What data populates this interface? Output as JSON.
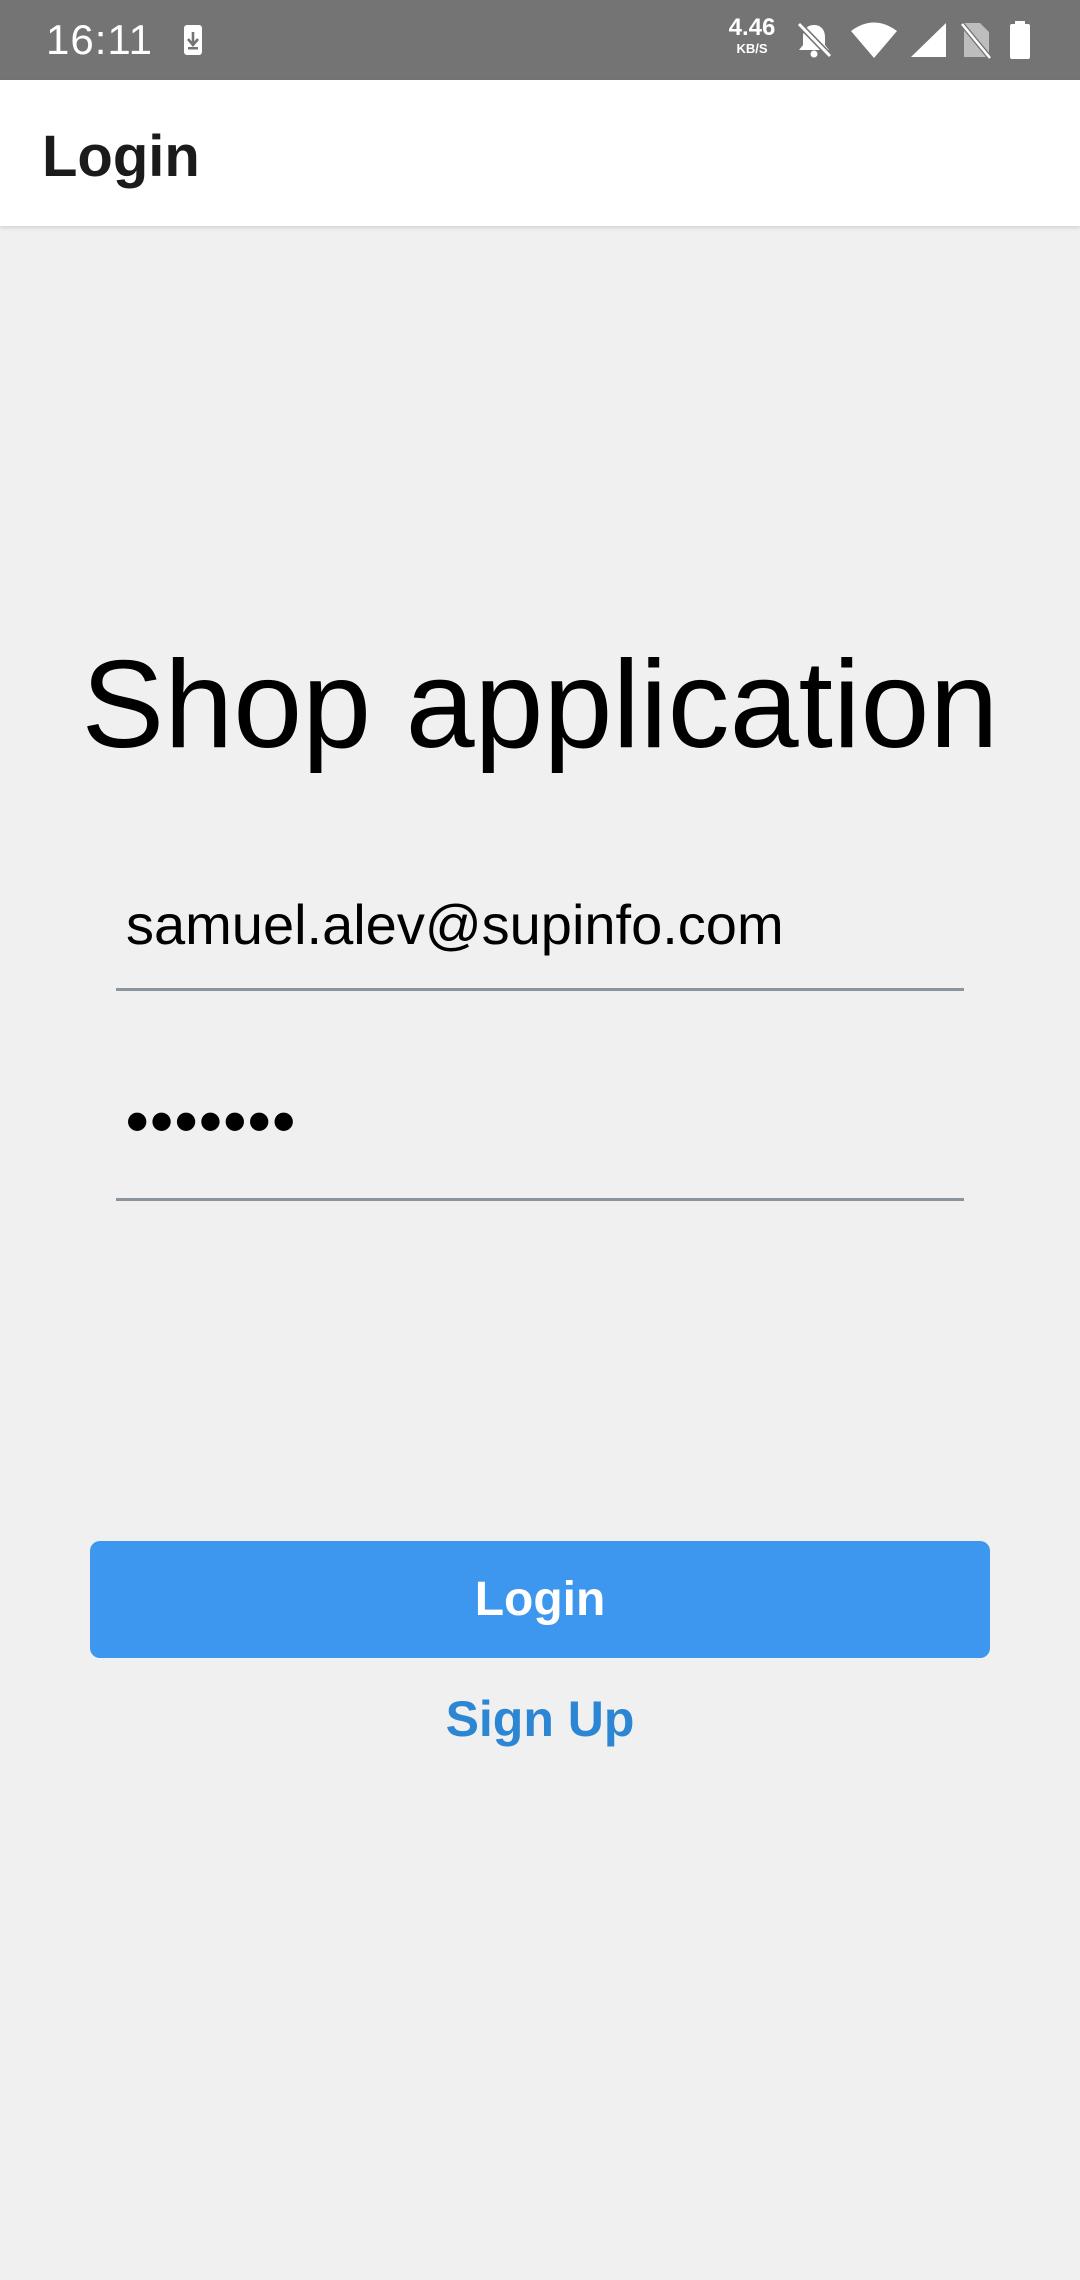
{
  "status_bar": {
    "time": "16:11",
    "speed_value": "4.46",
    "speed_unit": "KB/S",
    "icons": [
      "download-icon",
      "bell-off-icon",
      "wifi-icon",
      "cellular-signal-icon",
      "no-sim-icon",
      "battery-icon"
    ]
  },
  "app_bar": {
    "title": "Login"
  },
  "main": {
    "heading": "Shop application",
    "email_value": "samuel.alev@supinfo.com",
    "password_value": "•••••••",
    "login_label": "Login",
    "signup_label": "Sign Up"
  },
  "colors": {
    "status_bar_bg": "#747474",
    "app_bar_bg": "#ffffff",
    "page_bg": "#f0f0f0",
    "primary_button": "#3d97ee",
    "link": "#2c86d3",
    "field_underline": "#8c959d"
  }
}
